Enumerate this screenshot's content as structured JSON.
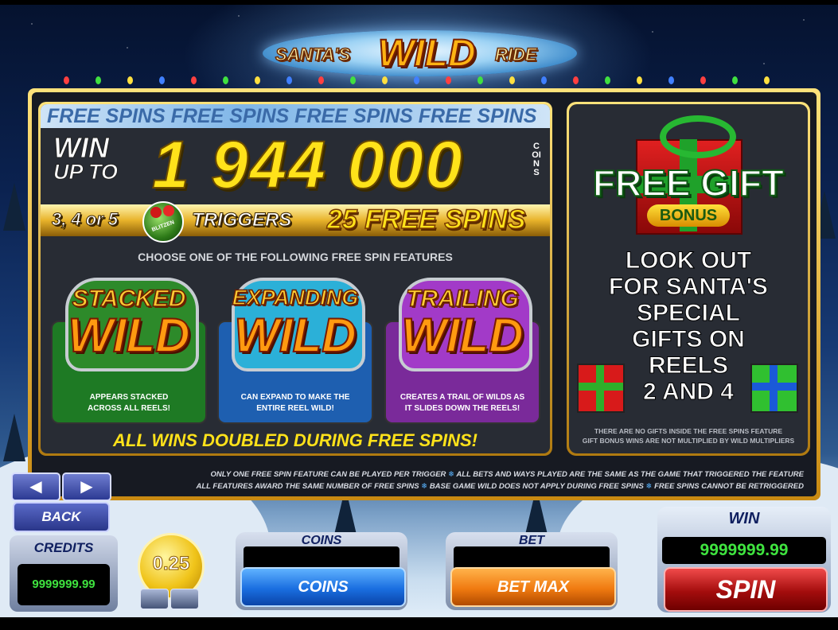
{
  "logo": {
    "left": "SANTA'S",
    "wild": "WILD",
    "right": "RIDE"
  },
  "free_spins": {
    "banner": "FREE SPINS FREE SPINS FREE SPINS FREE SPINS",
    "win_label_1": "WIN",
    "win_label_2": "UP TO",
    "win_amount": "1 944 000",
    "win_unit": "COINS",
    "trigger_counts": "3, 4 or 5",
    "scatter_symbol_label": "BLITZEN",
    "trigger_text": "TRIGGERS",
    "trigger_spins": "25 FREE SPINS",
    "choose_text": "CHOOSE ONE OF THE FOLLOWING FREE SPIN FEATURES",
    "features": [
      {
        "title": "STACKED",
        "wild": "WILD",
        "desc_1": "APPEARS STACKED",
        "desc_2": "ACROSS ALL REELS!",
        "color": "#1e7a24"
      },
      {
        "title": "EXPANDING",
        "wild": "WILD",
        "desc_1": "CAN EXPAND TO MAKE THE",
        "desc_2": "ENTIRE REEL WILD!",
        "color": "#1e5fb0"
      },
      {
        "title": "TRAILING",
        "wild": "WILD",
        "desc_1": "CREATES A TRAIL OF WILDS AS",
        "desc_2": "IT SLIDES DOWN THE REELS!",
        "color": "#7a2a9a"
      }
    ],
    "doubled": "ALL WINS DOUBLED DURING FREE SPINS!"
  },
  "free_gift": {
    "title": "FREE GIFT",
    "bonus": "BONUS",
    "lookout_1": "LOOK OUT",
    "lookout_2": "FOR SANTA'S",
    "lookout_3": "SPECIAL",
    "lookout_4": "GIFTS ON",
    "lookout_5": "REELS",
    "lookout_6": "2 AND 4",
    "no_gifts_1": "THERE ARE NO GIFTS INSIDE THE FREE SPINS FEATURE",
    "no_gifts_2": "GIFT BONUS WINS ARE NOT MULTIPLIED BY WILD MULTIPLIERS"
  },
  "footnote": {
    "line1_a": "ONLY ONE FREE SPIN FEATURE CAN BE PLAYED PER TRIGGER",
    "line1_b": "ALL BETS AND WAYS PLAYED ARE THE SAME AS THE GAME THAT TRIGGERED THE FEATURE",
    "line2_a": "ALL FEATURES AWARD THE SAME NUMBER OF FREE SPINS",
    "line2_b": "BASE GAME WILD DOES NOT APPLY DURING FREE SPINS",
    "line2_c": "FREE SPINS CANNOT BE RETRIGGERED"
  },
  "controls": {
    "prev_icon": "◀",
    "next_icon": "▶",
    "back": "BACK",
    "credits_label": "CREDITS",
    "credits_value": "9999999.99",
    "coin_value": "0.25",
    "coins_label": "COINS",
    "coins_button": "COINS",
    "bet_label": "BET",
    "bet_button": "BET MAX",
    "win_label": "WIN",
    "win_value": "9999999.99",
    "spin_button": "SPIN"
  }
}
